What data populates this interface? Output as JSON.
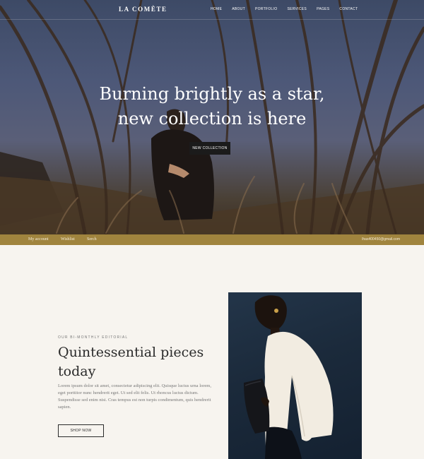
{
  "header": {
    "logo": "LA COMÈTE",
    "nav": [
      "HOME",
      "ABOUT",
      "PORTFOLIO",
      "SERVICES",
      "PAGES",
      "CONTACT"
    ]
  },
  "hero": {
    "headline_line1": "Burning brightly as a star,",
    "headline_line2": "new collection is here",
    "button_label": "NEW COLLECTION"
  },
  "utility_bar": {
    "account": "My account",
    "wishlist": "Wishlist",
    "search": "Serch",
    "email": "lhas400450@gmail.com"
  },
  "feature": {
    "eyebrow": "OUR BI-MONTHLY EDITORIAL",
    "title": "Quintessential pieces today",
    "body": "Lorem ipsum dolor sit amet, consectetur adipiscing elit. Quisque luctus urna lorem, eget porttitor nunc hendrerit eget. Ut sed elit felis. Ut rhoncus luctus dictum. Suspendisse sed enim nisi. Cras tempus est non turpis condimentum, quis hendrerit sapien.",
    "button_label": "SHOP NOW"
  },
  "colors": {
    "accent_bar": "#a0843e",
    "hero_button": "#1b1b1b",
    "page_background": "#f7f4ef"
  }
}
